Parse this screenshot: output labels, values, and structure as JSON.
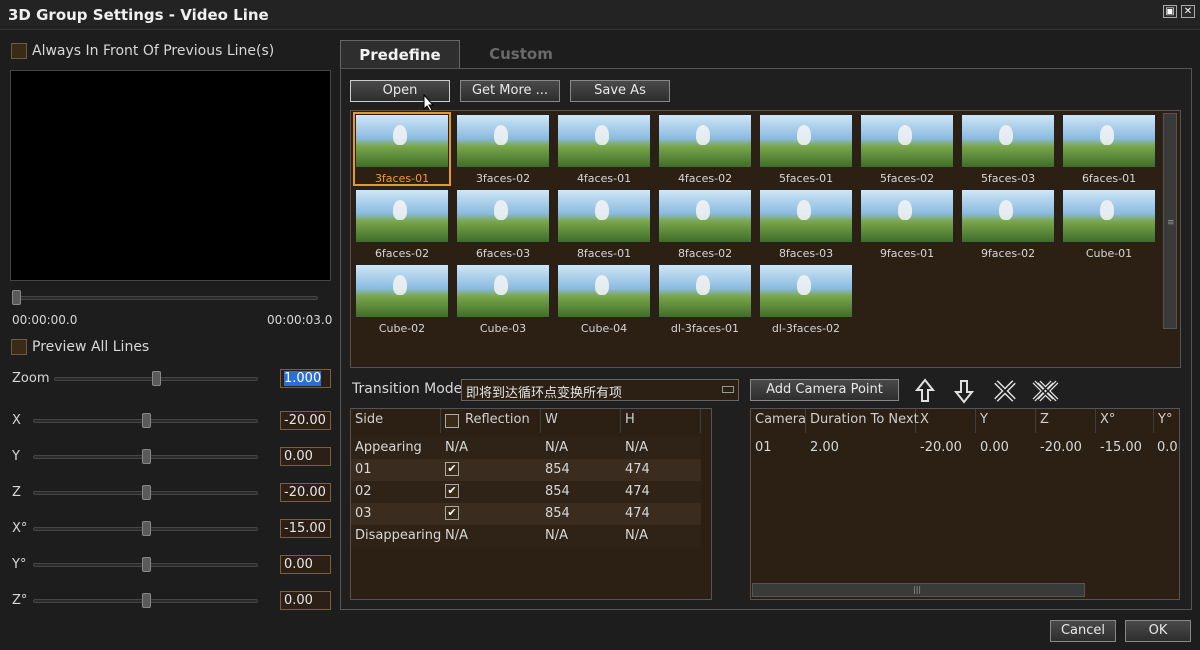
{
  "window": {
    "title": "3D Group Settings - Video Line",
    "restore_glyph": "▣",
    "close_glyph": "✕"
  },
  "left": {
    "always_front_label": "Always In Front Of Previous Line(s)",
    "time_start": "00:00:00.0",
    "time_end": "00:00:03.0",
    "preview_all_label": "Preview All Lines",
    "controls": [
      {
        "label": "Zoom",
        "value": "1.000",
        "level": 0.5
      },
      {
        "label": "X",
        "value": "-20.00",
        "level": 0.5
      },
      {
        "label": "Y",
        "value": "0.00",
        "level": 0.5
      },
      {
        "label": "Z",
        "value": "-20.00",
        "level": 0.5
      },
      {
        "label": "X°",
        "value": "-15.00",
        "level": 0.5
      },
      {
        "label": "Y°",
        "value": "0.00",
        "level": 0.5
      },
      {
        "label": "Z°",
        "value": "0.00",
        "level": 0.5
      }
    ]
  },
  "tabs": {
    "predefine": "Predefine",
    "custom": "Custom"
  },
  "toolbar": {
    "open": "Open",
    "get_more": "Get More ...",
    "save_as": "Save As"
  },
  "presets": [
    "3faces-01",
    "3faces-02",
    "4faces-01",
    "4faces-02",
    "5faces-01",
    "5faces-02",
    "5faces-03",
    "6faces-01",
    "6faces-02",
    "6faces-03",
    "8faces-01",
    "8faces-02",
    "8faces-03",
    "9faces-01",
    "9faces-02",
    "Cube-01",
    "Cube-02",
    "Cube-03",
    "Cube-04",
    "dl-3faces-01",
    "dl-3faces-02"
  ],
  "selected_preset": "3faces-01",
  "transition": {
    "label": "Transition Mode",
    "value": "即将到达循环点变换所有项",
    "add_camera": "Add Camera Point"
  },
  "sides_table": {
    "headers": {
      "side": "Side",
      "reflection": "Reflection",
      "w": "W",
      "h": "H"
    },
    "rows": [
      {
        "side": "Appearing",
        "refl": "N/A",
        "w": "N/A",
        "h": "N/A"
      },
      {
        "side": "01",
        "refl": "✔",
        "w": "854",
        "h": "474"
      },
      {
        "side": "02",
        "refl": "✔",
        "w": "854",
        "h": "474"
      },
      {
        "side": "03",
        "refl": "✔",
        "w": "854",
        "h": "474"
      },
      {
        "side": "Disappearing",
        "refl": "N/A",
        "w": "N/A",
        "h": "N/A"
      }
    ]
  },
  "camera_table": {
    "headers": {
      "camera": "Camera",
      "duration": "Duration To Next",
      "x": "X",
      "y": "Y",
      "z": "Z",
      "xd": "X°",
      "yd": "Y°"
    },
    "rows": [
      {
        "camera": "01",
        "duration": "2.00",
        "x": "-20.00",
        "y": "0.00",
        "z": "-20.00",
        "xd": "-15.00",
        "yd": "0.0"
      }
    ]
  },
  "footer": {
    "cancel": "Cancel",
    "ok": "OK"
  }
}
